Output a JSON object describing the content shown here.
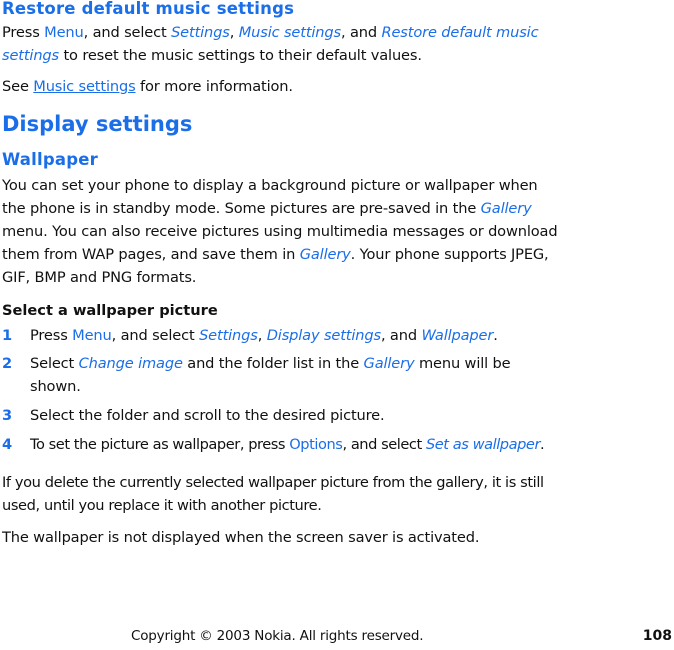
{
  "section_restore": {
    "title": "Restore default music settings",
    "para": {
      "t1": "Press ",
      "menu": "Menu",
      "t2": ", and select ",
      "settings": "Settings",
      "t3": ", ",
      "music_settings": "Music settings",
      "t4": ", and ",
      "restore_line1": "Restore default music",
      "restore_line2": "settings",
      "t5": " to reset the music settings to their default values."
    },
    "see": {
      "t1": "See ",
      "link": "Music settings",
      "t2": " for more information."
    }
  },
  "section_display": {
    "title": "Display settings"
  },
  "section_wallpaper": {
    "title": "Wallpaper",
    "lines": {
      "l1": "You can set your phone to display a background picture or wallpaper when",
      "l2a": "the phone is in standby mode. Some pictures are pre-saved in the ",
      "gallery1": "Gallery",
      "l3": "menu. You can also receive pictures using multimedia messages or download",
      "l4a": "them from WAP pages, and save them in ",
      "gallery2": "Gallery",
      "l4b": ". Your phone supports JPEG,",
      "l5": "GIF, BMP and PNG formats."
    },
    "subheading": "Select a wallpaper picture",
    "steps": [
      {
        "num": "1",
        "t1": "Press ",
        "menu": "Menu",
        "t2": ", and select ",
        "settings": "Settings",
        "t3": ", ",
        "display_settings": "Display settings",
        "t4": ", and ",
        "wallpaper": "Wallpaper",
        "t5": "."
      },
      {
        "num": "2",
        "t1": "Select ",
        "change_image": "Change image",
        "t2": " and the folder list in the ",
        "gallery": "Gallery",
        "t3": " menu will be",
        "t4": "shown."
      },
      {
        "num": "3",
        "text": "Select the folder and scroll to the desired picture."
      },
      {
        "num": "4",
        "t1": "To set the picture as wallpaper, press ",
        "options": "Options",
        "t2": ", and select ",
        "set_as_wallpaper": "Set as wallpaper",
        "t3": "."
      }
    ],
    "note1_l1": "If you delete the currently selected wallpaper picture from the gallery, it is still",
    "note1_l2": "used, until you replace it with another picture.",
    "note2": "The wallpaper is not displayed when the screen saver is activated."
  },
  "footer": {
    "copyright": "Copyright © 2003 Nokia. All rights reserved.",
    "page_number": "108"
  },
  "colors": {
    "accent": "#1a6ee8",
    "text": "#111111"
  }
}
